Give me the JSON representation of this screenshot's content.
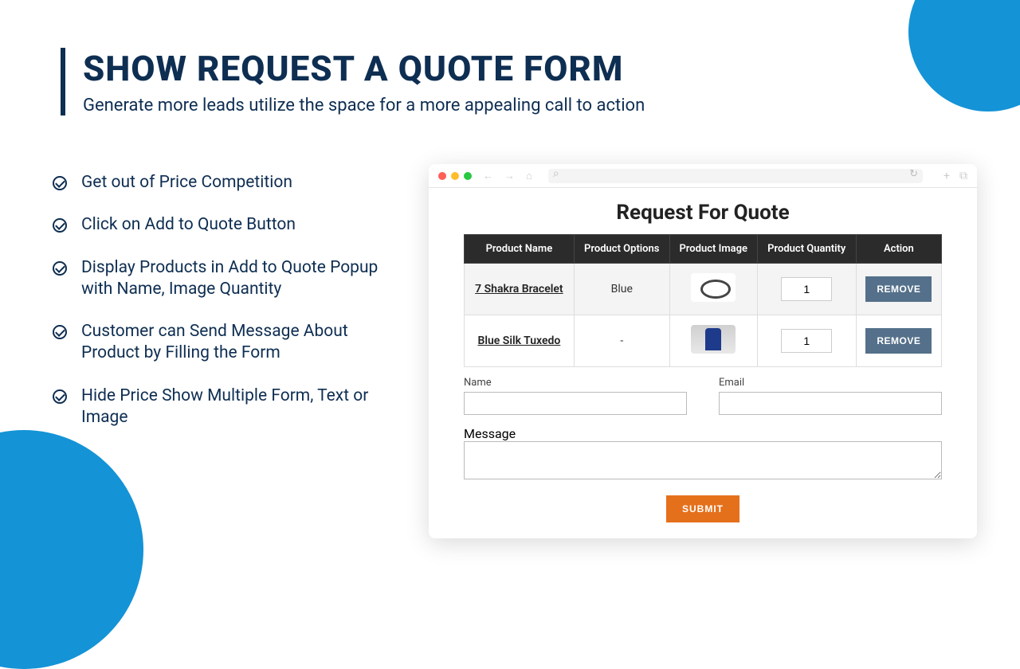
{
  "header": {
    "title": "SHOW REQUEST A QUOTE FORM",
    "subtitle": "Generate more leads utilize the space for a more appealing call to action"
  },
  "bullets": [
    "Get out of Price Competition",
    "Click on Add to Quote Button",
    "Display Products in Add to Quote Popup with Name, Image Quantity",
    "Customer can Send Message About Product by Filling the Form",
    "Hide Price Show Multiple Form, Text or Image"
  ],
  "form": {
    "title": "Request For Quote",
    "columns": [
      "Product Name",
      "Product Options",
      "Product Image",
      "Product Quantity",
      "Action"
    ],
    "rows": [
      {
        "name": "7 Shakra Bracelet",
        "options": "Blue",
        "qty": "1",
        "remove": "REMOVE",
        "imgClass": "bracelet"
      },
      {
        "name": "Blue Silk Tuxedo",
        "options": "-",
        "qty": "1",
        "remove": "REMOVE",
        "imgClass": "tux"
      }
    ],
    "fields": {
      "name_label": "Name",
      "email_label": "Email",
      "message_label": "Message"
    },
    "submit": "SUBMIT"
  }
}
